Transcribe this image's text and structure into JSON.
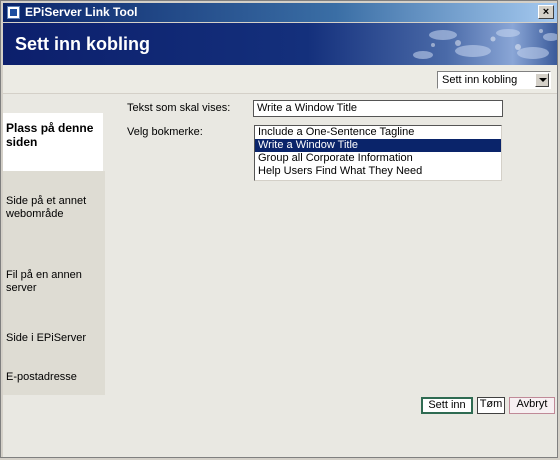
{
  "window": {
    "title": "EPiServer Link Tool",
    "close_label": "×"
  },
  "banner": {
    "title": "Sett inn kobling"
  },
  "link_type_select": {
    "selected": "Sett inn kobling"
  },
  "leftnav": {
    "items": [
      {
        "label": "Plass på denne siden",
        "active": true
      },
      {
        "label": "Side på et annet webområde",
        "active": false
      },
      {
        "label": "Fil på en annen server",
        "active": false
      },
      {
        "label": "Side i EPiServer",
        "active": false
      },
      {
        "label": "E-postadresse",
        "active": false
      }
    ]
  },
  "form": {
    "display_text_label": "Tekst som skal vises:",
    "display_text_value": "Write a Window Title",
    "bookmark_label": "Velg bokmerke:",
    "bookmarks": [
      "Include a One-Sentence Tagline",
      "Write a Window Title",
      "Group all Corporate Information",
      "Help Users Find What They Need"
    ],
    "selected_bookmark_index": 1
  },
  "buttons": {
    "insert": "Sett inn",
    "clear": "Tøm",
    "cancel": "Avbryt"
  },
  "colors": {
    "title_bar": "#0a246a",
    "banner": "#14307c",
    "selection": "#0a246a",
    "insert_border": "#2f6b52"
  }
}
